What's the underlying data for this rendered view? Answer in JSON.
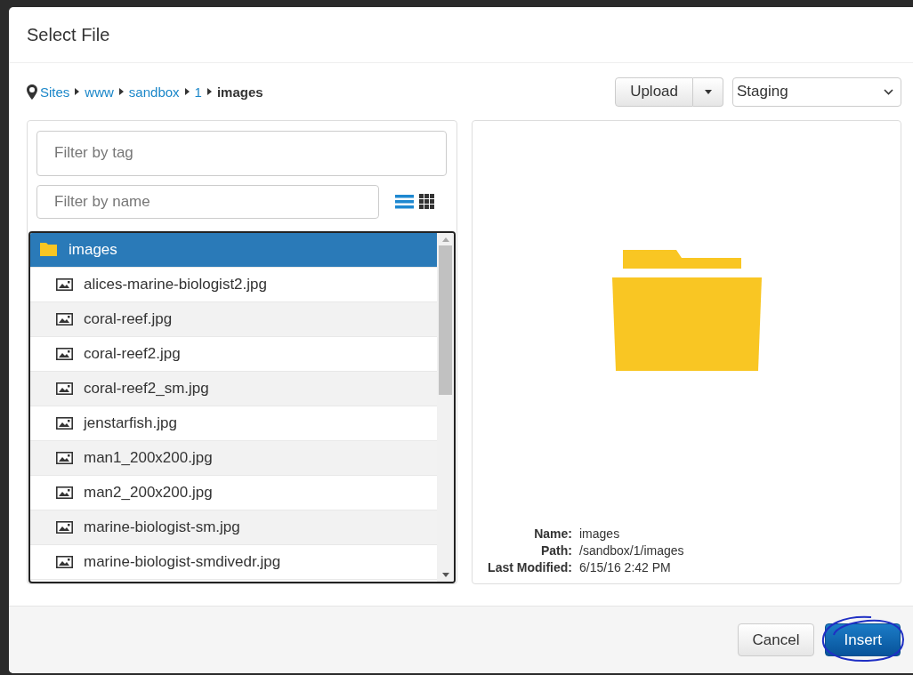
{
  "dialog": {
    "title": "Select File"
  },
  "breadcrumb": [
    {
      "label": "Sites",
      "current": false
    },
    {
      "label": "www",
      "current": false
    },
    {
      "label": "sandbox",
      "current": false
    },
    {
      "label": "1",
      "current": false
    },
    {
      "label": "images",
      "current": true
    }
  ],
  "upload_button": "Upload",
  "environment_select": {
    "value": "Staging"
  },
  "tag_filter": {
    "placeholder": "Filter by tag"
  },
  "name_filter": {
    "placeholder": "Filter by name"
  },
  "view_modes": [
    {
      "kind": "list",
      "selected": true
    },
    {
      "kind": "grid",
      "selected": false
    }
  ],
  "tree": {
    "name": "images",
    "selected": true,
    "children": [
      {
        "name": "alices-marine-biologist2.jpg",
        "selected": false
      },
      {
        "name": "coral-reef.jpg",
        "selected": false
      },
      {
        "name": "coral-reef2.jpg",
        "selected": false
      },
      {
        "name": "coral-reef2_sm.jpg",
        "selected": false
      },
      {
        "name": "jenstarfish.jpg",
        "selected": false
      },
      {
        "name": "man1_200x200.jpg",
        "selected": false
      },
      {
        "name": "man2_200x200.jpg",
        "selected": false
      },
      {
        "name": "marine-biologist-sm.jpg",
        "selected": false
      },
      {
        "name": "marine-biologist-smdivedr.jpg",
        "selected": false
      }
    ]
  },
  "details": [
    {
      "label": "Name:",
      "value": "images"
    },
    {
      "label": "Path:",
      "value": "/sandbox/1/images"
    },
    {
      "label": "Last Modified:",
      "value": "6/15/16 2:42 PM"
    }
  ],
  "buttons": [
    {
      "label": "Cancel",
      "kind": "default"
    },
    {
      "label": "Insert",
      "kind": "primary",
      "circled": true
    }
  ]
}
